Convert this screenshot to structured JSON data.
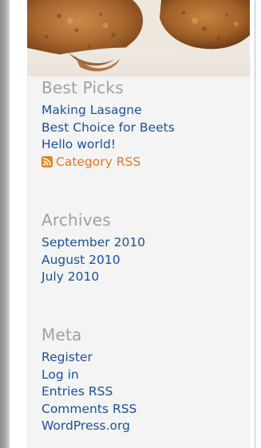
{
  "colors": {
    "heading": "#a0a0a0",
    "link": "#1b4f9c",
    "rss_link": "#e1781e",
    "panel": "#f4f4f4"
  },
  "header": {
    "image": "cookies-photo"
  },
  "widgets": {
    "best_picks": {
      "title": "Best Picks",
      "links": [
        "Making Lasagne",
        "Best Choice for Beets",
        "Hello world!"
      ],
      "rss_label": "Category RSS",
      "rss_icon": "rss-feed-icon"
    },
    "archives": {
      "title": "Archives",
      "links": [
        "September 2010",
        "August 2010",
        "July 2010"
      ]
    },
    "meta": {
      "title": "Meta",
      "links": [
        "Register",
        "Log in",
        "Entries RSS",
        "Comments RSS",
        "WordPress.org"
      ]
    }
  }
}
